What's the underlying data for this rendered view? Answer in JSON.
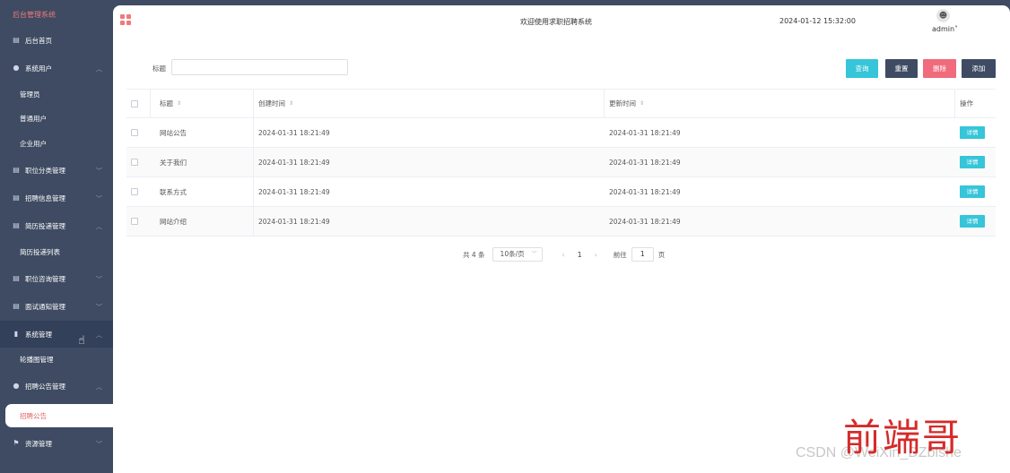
{
  "sidebar": {
    "brand": "后台管理系统",
    "items": [
      {
        "label": "后台首页",
        "icon": "home-icon"
      },
      {
        "label": "系统用户",
        "icon": "user-icon",
        "children": [
          "管理员",
          "普通用户",
          "企业用户"
        ]
      },
      {
        "label": "职位分类管理",
        "icon": "list-icon"
      },
      {
        "label": "招聘信息管理",
        "icon": "list-icon"
      },
      {
        "label": "简历投递管理",
        "icon": "list-icon",
        "children": [
          "简历投递列表"
        ]
      },
      {
        "label": "职位咨询管理",
        "icon": "list-icon"
      },
      {
        "label": "面试通知管理",
        "icon": "list-icon"
      },
      {
        "label": "系统管理",
        "icon": "bar-chart-icon",
        "children": [
          "轮播图管理"
        ]
      },
      {
        "label": "招聘公告管理",
        "icon": "info-icon",
        "children": [
          "招聘公告"
        ]
      },
      {
        "label": "资源管理",
        "icon": "flag-icon"
      }
    ]
  },
  "header": {
    "welcome": "欢迎使用求职招聘系统",
    "datetime": "2024-01-12 15:32:00",
    "user": "admin"
  },
  "search": {
    "label": "标题",
    "value": "",
    "buttons": {
      "query": "查询",
      "reset": "重置",
      "delete": "删除",
      "add": "添加"
    }
  },
  "table": {
    "columns": {
      "title": "标题",
      "created": "创建时间",
      "updated": "更新时间",
      "operation": "操作"
    },
    "rows": [
      {
        "title": "网站公告",
        "created": "2024-01-31 18:21:49",
        "updated": "2024-01-31 18:21:49",
        "action": "详情"
      },
      {
        "title": "关于我们",
        "created": "2024-01-31 18:21:49",
        "updated": "2024-01-31 18:21:49",
        "action": "详情"
      },
      {
        "title": "联系方式",
        "created": "2024-01-31 18:21:49",
        "updated": "2024-01-31 18:21:49",
        "action": "详情"
      },
      {
        "title": "网站介绍",
        "created": "2024-01-31 18:21:49",
        "updated": "2024-01-31 18:21:49",
        "action": "详情"
      }
    ]
  },
  "pagination": {
    "total": "共 4 条",
    "page_size": "10条/页",
    "current_page": "1",
    "goto_label": "前往",
    "goto_value": "1",
    "page_unit": "页"
  },
  "watermark": {
    "big": "前端哥",
    "small": "CSDN @WeiXin_DZbishe"
  },
  "colors": {
    "sidebar_bg": "#3e4b62",
    "accent_red": "#f07a7a",
    "query_btn": "#36c5d9",
    "delete_btn": "#f06b7c"
  }
}
